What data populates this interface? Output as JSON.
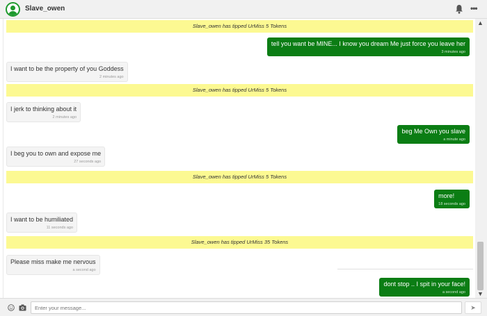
{
  "header": {
    "username": "Slave_owen",
    "notification_icon": "bell-icon",
    "menu_icon": "more-dots-icon"
  },
  "colors": {
    "accent": "#0b7d14",
    "tip_bg": "#fcf992",
    "incoming_bg": "#f4f4f4"
  },
  "messages": [
    {
      "type": "tip",
      "text": "Slave_owen has tipped UrMiss 5 Tokens"
    },
    {
      "type": "out",
      "text": "tell you want be MINE... I know you dream Me just force you leave her",
      "time": "3 minutes ago"
    },
    {
      "type": "in",
      "text": "I want to be the property of you Goddess",
      "time": "2 minutes ago"
    },
    {
      "type": "tip",
      "text": "Slave_owen has tipped UrMiss 5 Tokens"
    },
    {
      "type": "in",
      "text": "I jerk to thinking about it",
      "time": "2 minutes ago"
    },
    {
      "type": "out",
      "text": "beg Me Own you slave",
      "time": "a minute ago"
    },
    {
      "type": "in",
      "text": "I beg you to own and expose me",
      "time": "27 seconds ago"
    },
    {
      "type": "tip",
      "text": "Slave_owen has tipped UrMiss 5 Tokens"
    },
    {
      "type": "out",
      "text": "more!",
      "time": "18 seconds ago"
    },
    {
      "type": "in",
      "text": "I want to be humiliated",
      "time": "11 seconds ago"
    },
    {
      "type": "tip",
      "text": "Slave_owen has tipped UrMiss 35 Tokens"
    },
    {
      "type": "in",
      "text": "Please miss make me nervous",
      "time": "a second ago"
    },
    {
      "type": "out",
      "text": "dont stop .. I spit in your face!",
      "time": "a second ago"
    }
  ],
  "footer": {
    "emoji_icon": "smiley-icon",
    "camera_icon": "camera-icon",
    "input_placeholder": "Enter your message...",
    "input_value": "",
    "send_icon": "send-arrow-icon"
  }
}
